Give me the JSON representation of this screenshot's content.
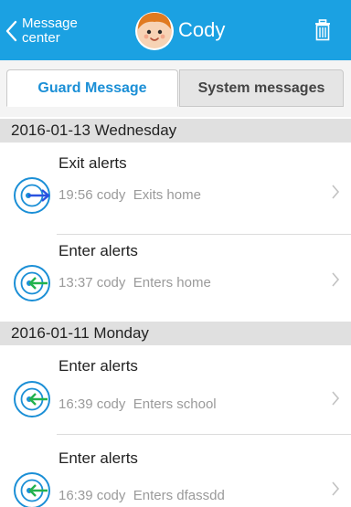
{
  "header": {
    "back_label": "Message center",
    "title": "Cody"
  },
  "tabs": [
    {
      "label": "Guard Message",
      "active": true
    },
    {
      "label": "System messages",
      "active": false
    }
  ],
  "groups": [
    {
      "date": "2016-01-13  Wednesday",
      "items": [
        {
          "title": "Exit alerts",
          "time": "19:56",
          "user": "cody",
          "action": "Exits home",
          "icon": "exit-alert-icon",
          "arrow_color": "#2a52e0"
        },
        {
          "title": "Enter alerts",
          "time": "13:37",
          "user": "cody",
          "action": "Enters home",
          "icon": "enter-alert-icon",
          "arrow_color": "#22b24c"
        }
      ]
    },
    {
      "date": "2016-01-11  Monday",
      "items": [
        {
          "title": "Enter alerts",
          "time": "16:39",
          "user": "cody",
          "action": "Enters school",
          "icon": "enter-alert-icon",
          "arrow_color": "#22b24c"
        },
        {
          "title": "Enter alerts",
          "time": "16:39",
          "user": "cody",
          "action": "Enters dfassdd",
          "icon": "enter-alert-icon",
          "arrow_color": "#22b24c"
        }
      ]
    }
  ],
  "colors": {
    "header_bg": "#1ba1e2",
    "active_tab_text": "#1b8fd6",
    "icon_ring": "#1b8fd6"
  }
}
